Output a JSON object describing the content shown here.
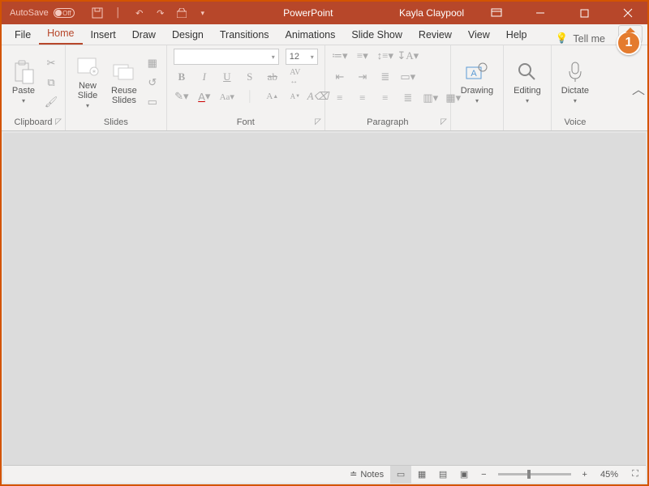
{
  "title": "PowerPoint",
  "user": "Kayla Claypool",
  "autosave": {
    "label": "AutoSave",
    "state": "Off"
  },
  "tabs": [
    "File",
    "Home",
    "Insert",
    "Draw",
    "Design",
    "Transitions",
    "Animations",
    "Slide Show",
    "Review",
    "View",
    "Help"
  ],
  "active_tab": "Home",
  "tellme": "Tell me",
  "groups": {
    "clipboard": {
      "label": "Clipboard",
      "paste": "Paste"
    },
    "slides": {
      "label": "Slides",
      "new": "New\nSlide",
      "reuse": "Reuse\nSlides"
    },
    "font": {
      "label": "Font",
      "size": "12"
    },
    "paragraph": {
      "label": "Paragraph"
    },
    "drawing": {
      "label": "Drawing"
    },
    "editing": {
      "label": "Editing"
    },
    "voice": {
      "label": "Voice",
      "dictate": "Dictate"
    }
  },
  "status": {
    "notes": "Notes",
    "zoom": "45%"
  },
  "callout": "1"
}
